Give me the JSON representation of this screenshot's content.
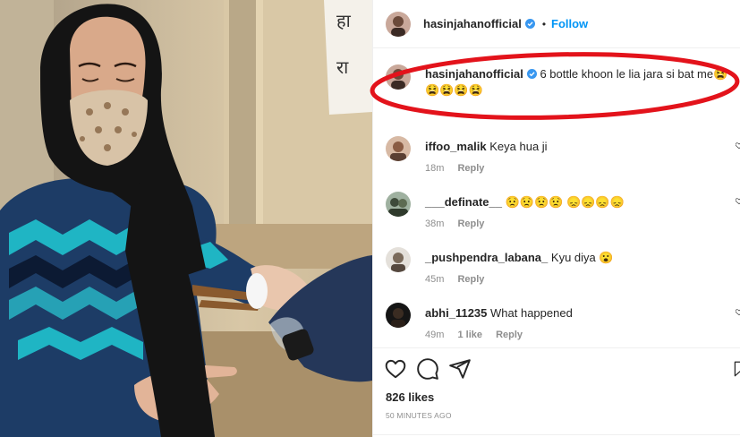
{
  "post": {
    "author": "hasinjahanofficial",
    "follow_label": "Follow",
    "dot": "•"
  },
  "caption": {
    "username": "hasinjahanofficial",
    "text": "6 bottle khoon le lia jara si bat me😫😫😫😫😫"
  },
  "comments": [
    {
      "username": "iffoo_malik",
      "text": "Keya hua ji",
      "time": "18m",
      "likes": "",
      "reply": "Reply"
    },
    {
      "username": "___definate__",
      "text": "😟😟😟😟 😞😞😞😞",
      "time": "38m",
      "likes": "",
      "reply": "Reply"
    },
    {
      "username": "_pushpendra_labana_",
      "text": "Kyu diya 😮",
      "time": "45m",
      "likes": "",
      "reply": "Reply"
    },
    {
      "username": "abhi_11235",
      "text": "What happened",
      "time": "49m",
      "likes": "1 like",
      "reply": "Reply"
    }
  ],
  "engagement": {
    "likes": "826 likes",
    "posted": "50 MINUTES AGO"
  },
  "photo_signs": [
    "हा",
    "रा"
  ],
  "icons": {
    "verified": "verified-badge-icon",
    "like": "heart-icon",
    "comment": "comment-bubble-icon",
    "share": "paper-plane-icon",
    "save": "bookmark-icon"
  },
  "colors": {
    "accent": "#0095f6",
    "annotation": "#e3131b",
    "muted": "#8e8e8e"
  }
}
